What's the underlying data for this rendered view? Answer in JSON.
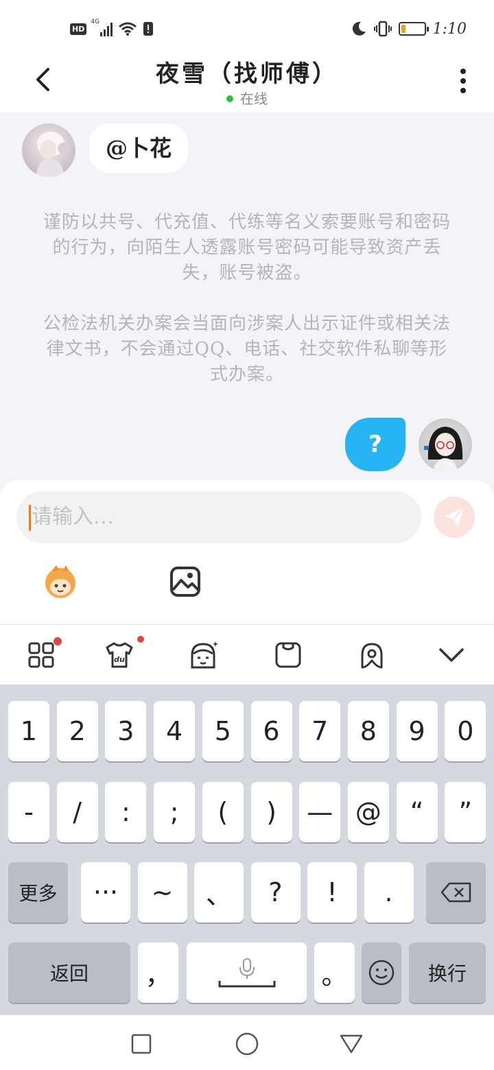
{
  "status_bar": {
    "hd_label": "HD",
    "network_label": "4G",
    "time": "1:10",
    "battery_level": 0.2,
    "battery_color": "#f2a31c"
  },
  "header": {
    "title": "夜雪（找师傅）",
    "status": "在线",
    "status_color": "#2cc33b"
  },
  "chat": {
    "incoming_message": "@卜花",
    "notice_1": "谨防以共号、代充值、代练等名义索要账号和密码的行为，向陌生人透露账号密码可能导致资产丢失，账号被盗。",
    "notice_2": "公检法机关办案会当面向涉案人出示证件或相关法律文书，不会通过QQ、电话、社交软件私聊等形式办案。",
    "outgoing_message": "?",
    "outgoing_bubble_color": "#27b4f7"
  },
  "composer": {
    "placeholder": "请输入…",
    "icons": [
      "emoji-sticker-icon",
      "image-icon",
      "send-icon"
    ]
  },
  "kb_toolbar": {
    "icons": [
      "apps-grid-icon",
      "skin-shirt-icon",
      "avatar-face-icon",
      "clipboard-icon",
      "location-icon",
      "collapse-chevron-icon"
    ]
  },
  "keyboard": {
    "row1": [
      "1",
      "2",
      "3",
      "4",
      "5",
      "6",
      "7",
      "8",
      "9",
      "0"
    ],
    "row2": [
      "-",
      "/",
      ":",
      ";",
      "(",
      ")",
      "—",
      "@",
      "“",
      "”"
    ],
    "row3": [
      "···",
      "~",
      "、",
      "?",
      "!",
      "."
    ],
    "more_label": "更多",
    "back_label": "返回",
    "comma": "，",
    "period": "。",
    "enter_label": "换行"
  },
  "navbar": {
    "icons": [
      "recent-apps-icon",
      "home-icon",
      "back-icon"
    ]
  }
}
